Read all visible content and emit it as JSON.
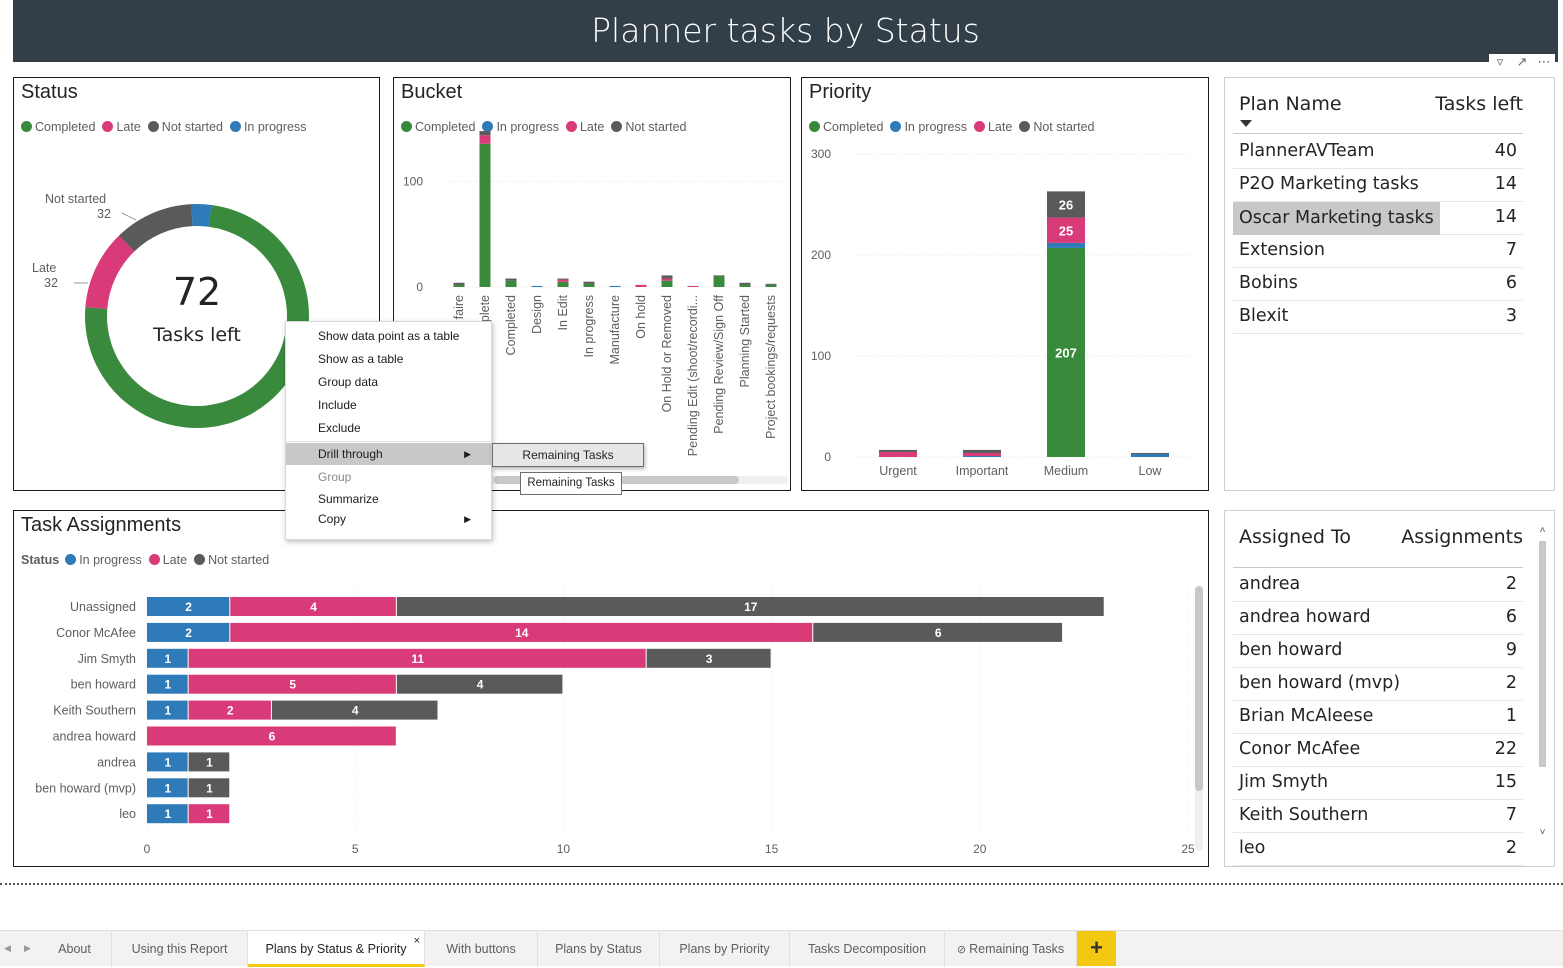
{
  "title": "Planner tasks by Status",
  "colors": {
    "completed": "#3a8a3e",
    "in_progress": "#2f7ab8",
    "late": "#d93a78",
    "not_started": "#5a5a5a",
    "banner": "#323f48",
    "tab_accent": "#f2c811"
  },
  "header_icons": [
    "filter-icon",
    "focus-mode-icon",
    "more-options-icon"
  ],
  "status": {
    "title": "Status",
    "legend": [
      "Completed",
      "Late",
      "Not started",
      "In progress"
    ],
    "center_value": "72",
    "center_label": "Tasks left",
    "labels": {
      "not_started": "Not started",
      "not_started_value": "32",
      "late": "Late",
      "late_value": "32"
    }
  },
  "bucket": {
    "title": "Bucket",
    "legend": [
      "Completed",
      "In progress",
      "Late",
      "Not started"
    ],
    "y_ticks": [
      "100",
      "0"
    ],
    "categories": [
      "faire",
      "plete",
      "Completed",
      "Design",
      "In Edit",
      "In progress",
      "Manufacture",
      "On hold",
      "On Hold or Removed",
      "Pending Edit (shoot/recordi...",
      "Pending Review/Sign Off",
      "Planning Started",
      "Project bookings/requests"
    ]
  },
  "priority": {
    "title": "Priority",
    "legend": [
      "Completed",
      "In progress",
      "Late",
      "Not started"
    ],
    "y_ticks": [
      "300",
      "200",
      "100",
      "0"
    ],
    "data_labels": [
      "26",
      "25",
      "207"
    ]
  },
  "plan_table": {
    "col1": "Plan Name",
    "col2": "Tasks left",
    "rows": [
      {
        "name": "PlannerAVTeam",
        "value": "40"
      },
      {
        "name": "P2O Marketing tasks",
        "value": "14"
      },
      {
        "name": "Oscar Marketing tasks",
        "value": "14"
      },
      {
        "name": "Extension",
        "value": "7"
      },
      {
        "name": "Bobins",
        "value": "6"
      },
      {
        "name": "Blexit",
        "value": "3"
      }
    ]
  },
  "assignments": {
    "title": "Task Assignments",
    "legend_title": "Status",
    "legend": [
      "In progress",
      "Late",
      "Not started"
    ]
  },
  "assigned_table": {
    "col1": "Assigned To",
    "col2": "Assignments",
    "rows": [
      {
        "name": "andrea",
        "value": "2"
      },
      {
        "name": "andrea howard",
        "value": "6"
      },
      {
        "name": "ben howard",
        "value": "9"
      },
      {
        "name": "ben howard (mvp)",
        "value": "2"
      },
      {
        "name": "Brian McAleese",
        "value": "1"
      },
      {
        "name": "Conor McAfee",
        "value": "22"
      },
      {
        "name": "Jim Smyth",
        "value": "15"
      },
      {
        "name": "Keith Southern",
        "value": "7"
      },
      {
        "name": "leo",
        "value": "2"
      }
    ]
  },
  "context_menu": {
    "items": [
      "Show data point as a table",
      "Show as a table",
      "Group data",
      "Include",
      "Exclude",
      "Drill through",
      "Group",
      "Summarize",
      "Copy"
    ],
    "submenu": "Remaining Tasks",
    "tooltip": "Remaining Tasks"
  },
  "tabs": [
    "About",
    "Using this Report",
    "Plans by Status & Priority",
    "With buttons",
    "Plans by Status",
    "Plans by Priority",
    "Tasks Decomposition",
    "Remaining Tasks"
  ],
  "tab_close": "×",
  "add_tab": "+",
  "chart_data": [
    {
      "type": "pie",
      "title": "Status",
      "categories": [
        "Completed",
        "Late",
        "Not started",
        "In progress"
      ],
      "values": [
        207,
        32,
        32,
        8
      ],
      "center_text": "72 Tasks left"
    },
    {
      "type": "bar",
      "title": "Bucket",
      "categories": [
        "faire",
        "plete",
        "Completed",
        "Design",
        "In Edit",
        "In progress",
        "Manufacture",
        "On hold",
        "On Hold or Removed",
        "Pending Edit (shoot/recordi...",
        "Pending Review/Sign Off",
        "Planning Started",
        "Project bookings/requests"
      ],
      "series": [
        {
          "name": "Completed",
          "values": [
            2,
            136,
            6,
            0,
            5,
            3,
            0,
            0,
            6,
            0,
            10,
            2,
            2
          ]
        },
        {
          "name": "In progress",
          "values": [
            0,
            0,
            0,
            1,
            0,
            0,
            1,
            0,
            0,
            0,
            0,
            0,
            0
          ]
        },
        {
          "name": "Late",
          "values": [
            0,
            8,
            0,
            0,
            2,
            0,
            0,
            2,
            2,
            1,
            0,
            0,
            0
          ]
        },
        {
          "name": "Not started",
          "values": [
            2,
            4,
            2,
            0,
            1,
            2,
            0,
            0,
            3,
            0,
            1,
            2,
            1
          ]
        }
      ],
      "ylim": [
        0,
        150
      ]
    },
    {
      "type": "bar",
      "title": "Priority",
      "categories": [
        "Urgent",
        "Important",
        "Medium",
        "Low"
      ],
      "series": [
        {
          "name": "Completed",
          "values": [
            0,
            0,
            207,
            0
          ]
        },
        {
          "name": "In progress",
          "values": [
            0,
            1,
            5,
            3
          ]
        },
        {
          "name": "Late",
          "values": [
            5,
            3,
            25,
            0
          ]
        },
        {
          "name": "Not started",
          "values": [
            2,
            3,
            26,
            1
          ]
        }
      ],
      "y_ticks": [
        0,
        100,
        200,
        300
      ],
      "ylim": [
        0,
        300
      ]
    },
    {
      "type": "bar",
      "orientation": "horizontal",
      "title": "Task Assignments",
      "categories": [
        "Unassigned",
        "Conor McAfee",
        "Jim Smyth",
        "ben howard",
        "Keith Southern",
        "andrea howard",
        "andrea",
        "ben howard (mvp)",
        "leo"
      ],
      "series": [
        {
          "name": "In progress",
          "values": [
            2,
            2,
            1,
            1,
            1,
            0,
            1,
            1,
            1
          ]
        },
        {
          "name": "Late",
          "values": [
            4,
            14,
            11,
            5,
            2,
            6,
            0,
            0,
            1
          ]
        },
        {
          "name": "Not started",
          "values": [
            17,
            6,
            3,
            4,
            4,
            0,
            1,
            1,
            0
          ]
        }
      ],
      "x_ticks": [
        0,
        5,
        10,
        15,
        20,
        25
      ],
      "xlim": [
        0,
        25
      ]
    }
  ]
}
